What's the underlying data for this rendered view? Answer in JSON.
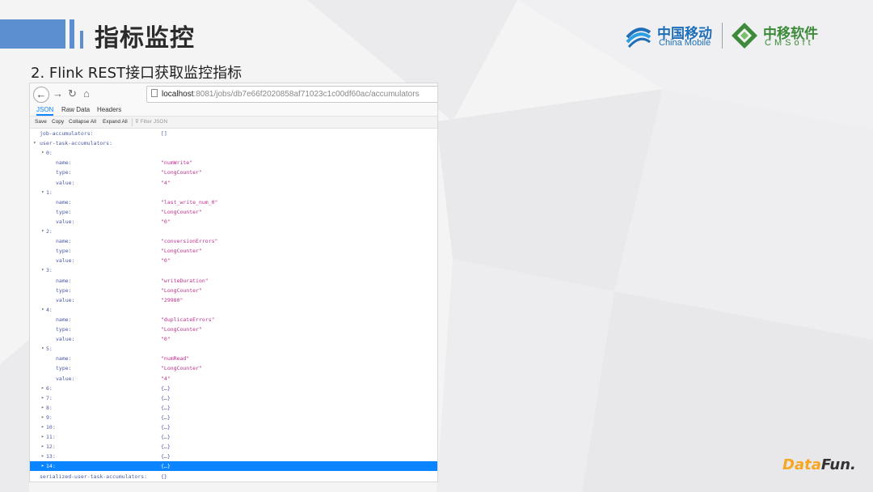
{
  "header": {
    "title": "指标监控",
    "subtitle": "2. Flink REST接口获取监控指标",
    "logo_cm_cn": "中国移动",
    "logo_cm_en": "China Mobile",
    "logo_soft_cn": "中移软件",
    "logo_soft_en": "CMSoft"
  },
  "browser": {
    "url_host": "localhost",
    "url_rest": ":8081/jobs/db7e66f2020858af71023c1c00df60ac/accumulators",
    "tabs": [
      "JSON",
      "Raw Data",
      "Headers"
    ],
    "active_tab": "JSON",
    "toolbar": {
      "save": "Save",
      "copy": "Copy",
      "collapse_all": "Collapse All",
      "expand_all": "Expand All",
      "filter_placeholder": "Filter JSON"
    }
  },
  "json_rows": [
    {
      "indent": 0,
      "key": "job-accumulators:",
      "value": "[]",
      "plain": true
    },
    {
      "indent": 0,
      "arrow": "▾",
      "key": "user-task-accumulators:"
    },
    {
      "indent": 1,
      "arrow": "▾",
      "key": "0:"
    },
    {
      "indent": 2,
      "key": "name:",
      "value": "\"numWrite\""
    },
    {
      "indent": 2,
      "key": "type:",
      "value": "\"LongCounter\""
    },
    {
      "indent": 2,
      "key": "value:",
      "value": "\"4\""
    },
    {
      "indent": 1,
      "arrow": "▾",
      "key": "1:"
    },
    {
      "indent": 2,
      "key": "name:",
      "value": "\"last_write_num_0\""
    },
    {
      "indent": 2,
      "key": "type:",
      "value": "\"LongCounter\""
    },
    {
      "indent": 2,
      "key": "value:",
      "value": "\"0\""
    },
    {
      "indent": 1,
      "arrow": "▾",
      "key": "2:"
    },
    {
      "indent": 2,
      "key": "name:",
      "value": "\"conversionErrors\""
    },
    {
      "indent": 2,
      "key": "type:",
      "value": "\"LongCounter\""
    },
    {
      "indent": 2,
      "key": "value:",
      "value": "\"0\""
    },
    {
      "indent": 1,
      "arrow": "▾",
      "key": "3:"
    },
    {
      "indent": 2,
      "key": "name:",
      "value": "\"writeDuration\""
    },
    {
      "indent": 2,
      "key": "type:",
      "value": "\"LongCounter\""
    },
    {
      "indent": 2,
      "key": "value:",
      "value": "\"29980\""
    },
    {
      "indent": 1,
      "arrow": "▾",
      "key": "4:"
    },
    {
      "indent": 2,
      "key": "name:",
      "value": "\"duplicateErrors\""
    },
    {
      "indent": 2,
      "key": "type:",
      "value": "\"LongCounter\""
    },
    {
      "indent": 2,
      "key": "value:",
      "value": "\"0\""
    },
    {
      "indent": 1,
      "arrow": "▾",
      "key": "5:"
    },
    {
      "indent": 2,
      "key": "name:",
      "value": "\"numRead\""
    },
    {
      "indent": 2,
      "key": "type:",
      "value": "\"LongCounter\""
    },
    {
      "indent": 2,
      "key": "value:",
      "value": "\"4\""
    },
    {
      "indent": 1,
      "arrow": "▸",
      "key": "6:",
      "value": "{…}",
      "plain": true
    },
    {
      "indent": 1,
      "arrow": "▸",
      "key": "7:",
      "value": "{…}",
      "plain": true
    },
    {
      "indent": 1,
      "arrow": "▸",
      "key": "8:",
      "value": "{…}",
      "plain": true
    },
    {
      "indent": 1,
      "arrow": "▸",
      "key": "9:",
      "value": "{…}",
      "plain": true
    },
    {
      "indent": 1,
      "arrow": "▸",
      "key": "10:",
      "value": "{…}",
      "plain": true
    },
    {
      "indent": 1,
      "arrow": "▸",
      "key": "11:",
      "value": "{…}",
      "plain": true
    },
    {
      "indent": 1,
      "arrow": "▸",
      "key": "12:",
      "value": "{…}",
      "plain": true
    },
    {
      "indent": 1,
      "arrow": "▸",
      "key": "13:",
      "value": "{…}",
      "plain": true
    },
    {
      "indent": 1,
      "arrow": "▸",
      "key": "14:",
      "value": "{…}",
      "plain": true,
      "selected": true
    },
    {
      "indent": 0,
      "key": "serialized-user-task-accumulators:",
      "value": "{}",
      "plain": true
    }
  ],
  "footer": {
    "brand_a": "Data",
    "brand_b": "Fun."
  },
  "colors": {
    "accent": "#5b8fd0",
    "selection": "#0a84ff",
    "json_key": "#4a58a3",
    "json_string": "#c02e8e"
  }
}
